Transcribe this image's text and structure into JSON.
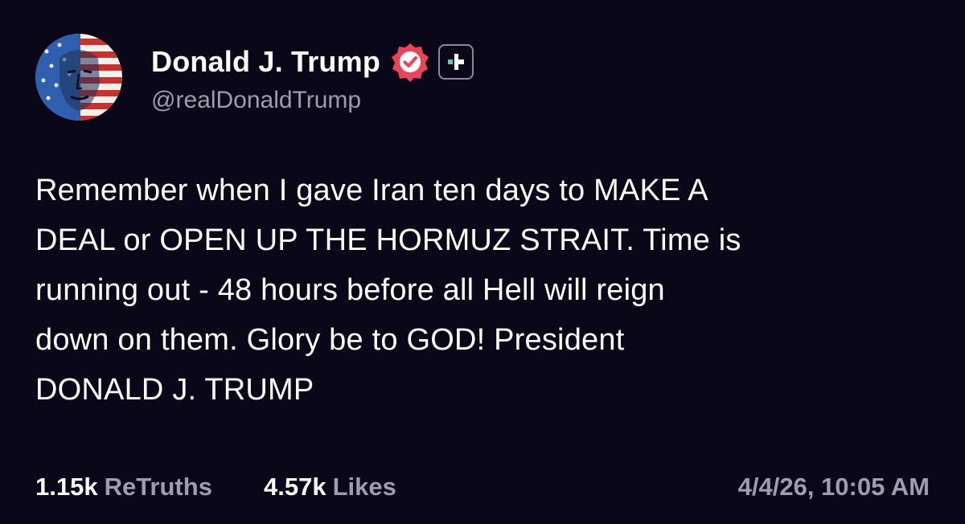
{
  "author": {
    "display_name": "Donald J. Trump",
    "handle": "@realDonaldTrump"
  },
  "post": {
    "lines": [
      "Remember when I gave Iran ten days to MAKE A",
      "DEAL or OPEN UP THE HORMUZ STRAIT. Time is",
      "running out - 48 hours before all Hell will reign",
      "down on them. Glory be to GOD! President",
      "DONALD J. TRUMP"
    ]
  },
  "stats": {
    "retruths_count": "1.15k",
    "retruths_label": "ReTruths",
    "likes_count": "4.57k",
    "likes_label": "Likes"
  },
  "timestamp": "4/4/26, 10:05 AM",
  "colors": {
    "background": "#0a0818",
    "text": "#ffffff",
    "muted": "#9e9cae",
    "verified_badge": "#e8455a"
  },
  "icons": {
    "verified": "verified-badge-icon",
    "plus": "truth-plus-icon"
  }
}
